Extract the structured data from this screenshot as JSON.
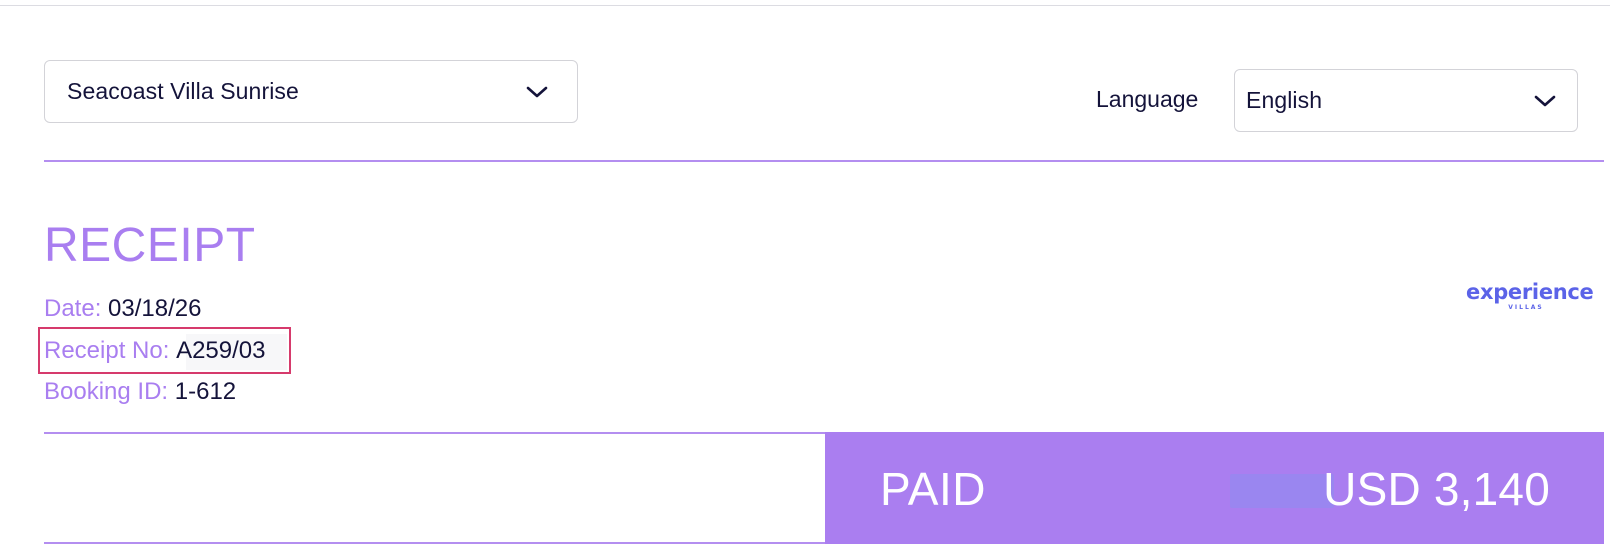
{
  "header": {
    "property_select": {
      "value": "Seacoast Villa Sunrise"
    },
    "language": {
      "label": "Language",
      "value": "English"
    }
  },
  "receipt": {
    "title": "RECEIPT",
    "date": {
      "label": "Date:",
      "value": "03/18/26"
    },
    "receipt_no": {
      "label": "Receipt No:",
      "value": "A259/03"
    },
    "booking_id": {
      "label": "Booking ID:",
      "value": "1-612"
    },
    "brand": {
      "name": "experience",
      "subname": "VILLAS"
    }
  },
  "total": {
    "status": "PAID",
    "amount": "USD 3,140"
  },
  "colors": {
    "accent": "#a97ef0",
    "brand_logo": "#5b63e8",
    "highlight_border": "#d63a6c",
    "text": "#14133a"
  }
}
